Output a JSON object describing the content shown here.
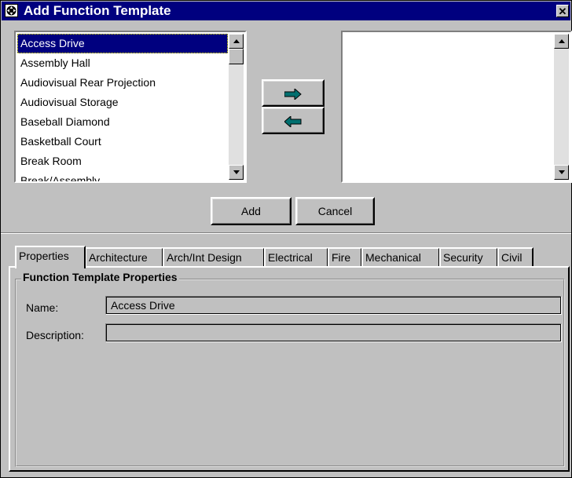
{
  "window": {
    "title": "Add Function Template",
    "close_glyph": "✕"
  },
  "available_list": {
    "items": [
      "Access Drive",
      "Assembly Hall",
      "Audiovisual Rear Projection",
      "Audiovisual Storage",
      "Baseball Diamond",
      "Basketball Court",
      "Break Room",
      "Break/Assembly"
    ],
    "selected_index": 0
  },
  "transfer": {
    "add_arrow": "➡",
    "remove_arrow": "⬅",
    "arrow_color": "#006f6f"
  },
  "actions": {
    "add_label": "Add",
    "cancel_label": "Cancel"
  },
  "tabs": [
    "Properties",
    "Architecture",
    "Arch/Int Design",
    "Electrical",
    "Fire",
    "Mechanical",
    "Security",
    "Civil"
  ],
  "active_tab": "Properties",
  "properties": {
    "group_title": "Function Template Properties",
    "name_label": "Name:",
    "name_value": "Access Drive",
    "description_label": "Description:",
    "description_value": ""
  },
  "colors": {
    "titlebar": "#00007f",
    "selection": "#00007f",
    "face": "#c0c0c0"
  }
}
